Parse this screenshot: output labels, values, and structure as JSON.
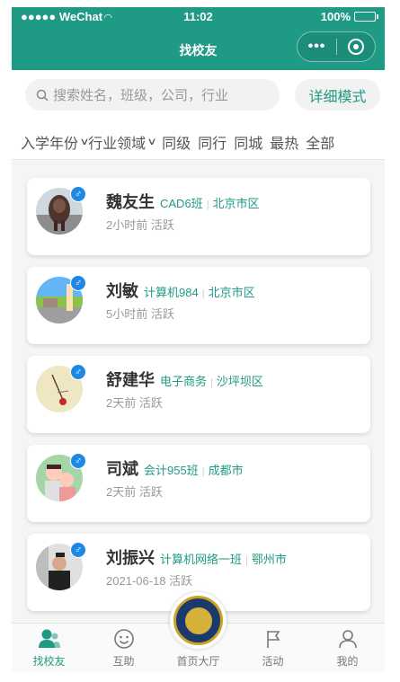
{
  "status": {
    "carrier": "●●●●● WeChat",
    "time": "11:02",
    "battery": "100%"
  },
  "nav": {
    "title": "找校友",
    "more_icon": "more-dots-icon",
    "close_icon": "circle-close-icon"
  },
  "search": {
    "placeholder": "搜索姓名，班级，公司，行业",
    "detail_button": "详细模式"
  },
  "filters": {
    "year": "入学年份",
    "industry": "行业领域",
    "options": [
      "同级",
      "同行",
      "同城",
      "最热",
      "全部"
    ]
  },
  "alumni": [
    {
      "name": "魏友生",
      "class": "CAD6班",
      "city": "北京市区",
      "active": "2小时前 活跃",
      "gender": "♂"
    },
    {
      "name": "刘敏",
      "class": "计算机984",
      "city": "北京市区",
      "active": "5小时前 活跃",
      "gender": "♂"
    },
    {
      "name": "舒建华",
      "class": "电子商务",
      "city": "沙坪坝区",
      "active": "2天前 活跃",
      "gender": "♂"
    },
    {
      "name": "司斌",
      "class": "会计955班",
      "city": "成都市",
      "active": "2天前 活跃",
      "gender": "♂"
    },
    {
      "name": "刘振兴",
      "class": "计算机网络一班",
      "city": "鄂州市",
      "active": "2021-06-18 活跃",
      "gender": "♂"
    }
  ],
  "tabs": [
    {
      "label": "找校友",
      "icon": "alumni-icon"
    },
    {
      "label": "互助",
      "icon": "smile-icon"
    },
    {
      "label": "首页大厅",
      "icon": "school-seal-icon"
    },
    {
      "label": "活动",
      "icon": "flag-icon"
    },
    {
      "label": "我的",
      "icon": "user-icon"
    }
  ],
  "colors": {
    "accent": "#1f9a84",
    "gender_badge": "#1e88e5"
  }
}
